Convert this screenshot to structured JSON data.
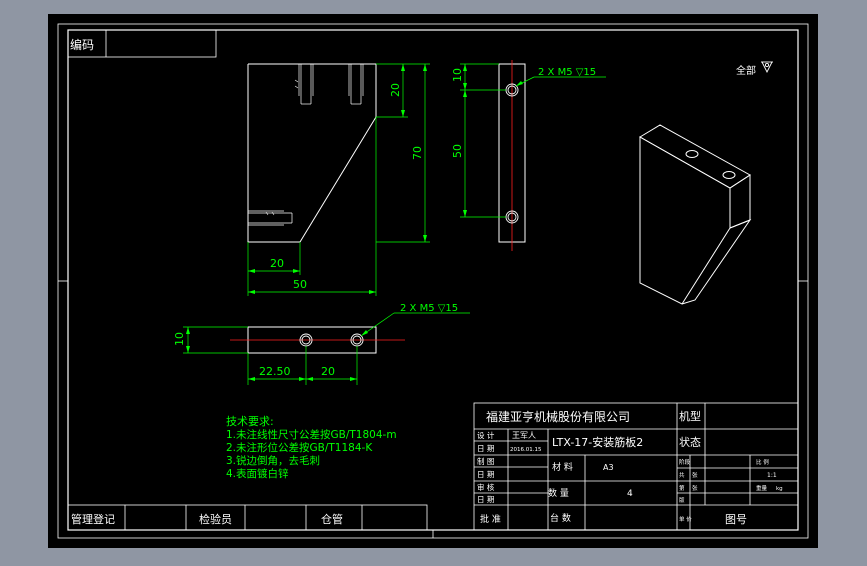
{
  "colors": {
    "window_bg": "#8f96a3",
    "paper": "#000000",
    "geometry": "#ffffff",
    "dimension": "#00ff00",
    "centerline": "#ff2020"
  },
  "code_box": {
    "label": "编码"
  },
  "view_label": {
    "text": "全部"
  },
  "front_view": {
    "dim_width": "50",
    "dim_chamfer_width": "20",
    "dim_height": "70",
    "dim_top": "20"
  },
  "side_view": {
    "dim_top": "10",
    "dim_spacing": "50",
    "hole_note": "2 X M5  ▽15"
  },
  "top_view": {
    "dim_thickness": "10",
    "dim_first": "22.50",
    "dim_second": "20",
    "hole_note": "2 X M5  ▽15"
  },
  "notes": {
    "heading": "技术要求:",
    "lines": [
      "1.未注线性尺寸公差按GB/T1804-m",
      "2.未注形位公差按GB/T1184-K",
      "3.锐边倒角，去毛刺",
      "4.表面镀白锌"
    ]
  },
  "title_block": {
    "company": "福建亚亨机械股份有限公司",
    "part_name": "LTX-17-安装筋板2",
    "machine_label": "机型",
    "status_label": "状态",
    "design_label": "设 计",
    "designer": "王军人",
    "date_label": "日 期",
    "design_date": "2016.01.15",
    "review_label": "制 图",
    "check_label": "审 核",
    "approve_label": "批 准",
    "material_label": "材 料",
    "material": "A3",
    "quantity_label": "数 量",
    "quantity": "4",
    "units_label": "台 数",
    "ratio_label": "比 例",
    "ratio": "1:1",
    "weight_label": "重量",
    "weight": "kg",
    "archive_label": "单 价",
    "drawing_no_label": "图号",
    "small_labels": [
      "阶段",
      "共",
      "张",
      "第",
      "张",
      "版"
    ]
  },
  "bottom_bar": {
    "registry": "管理登记",
    "inspector": "检验员",
    "location": "仓管"
  }
}
